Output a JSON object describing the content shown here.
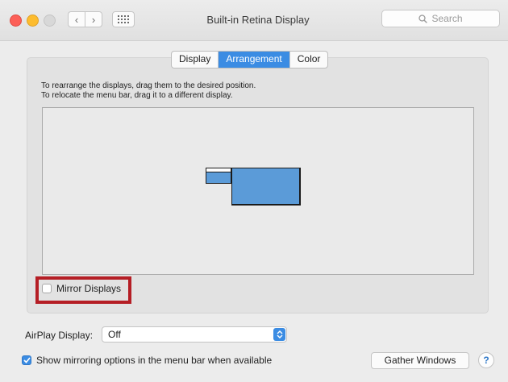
{
  "window": {
    "title": "Built-in Retina Display",
    "search_placeholder": "Search",
    "back_glyph": "‹",
    "forward_glyph": "›"
  },
  "tabs": [
    {
      "label": "Display",
      "active": false
    },
    {
      "label": "Arrangement",
      "active": true
    },
    {
      "label": "Color",
      "active": false
    }
  ],
  "instructions": {
    "line1": "To rearrange the displays, drag them to the desired position.",
    "line2": "To relocate the menu bar, drag it to a different display."
  },
  "mirror_displays": {
    "label": "Mirror Displays",
    "checked": false
  },
  "airplay": {
    "label": "AirPlay Display:",
    "value": "Off"
  },
  "show_mirroring": {
    "label": "Show mirroring options in the menu bar when available",
    "checked": true
  },
  "buttons": {
    "gather_windows": "Gather Windows",
    "help": "?"
  },
  "colors": {
    "accent": "#3b8ce3",
    "highlight": "#b51e25",
    "display_fill": "#5b9bd8"
  },
  "icons": [
    "back-icon",
    "forward-icon",
    "show-all-grid-icon",
    "search-icon",
    "checkmark-icon",
    "stepper-icon"
  ]
}
